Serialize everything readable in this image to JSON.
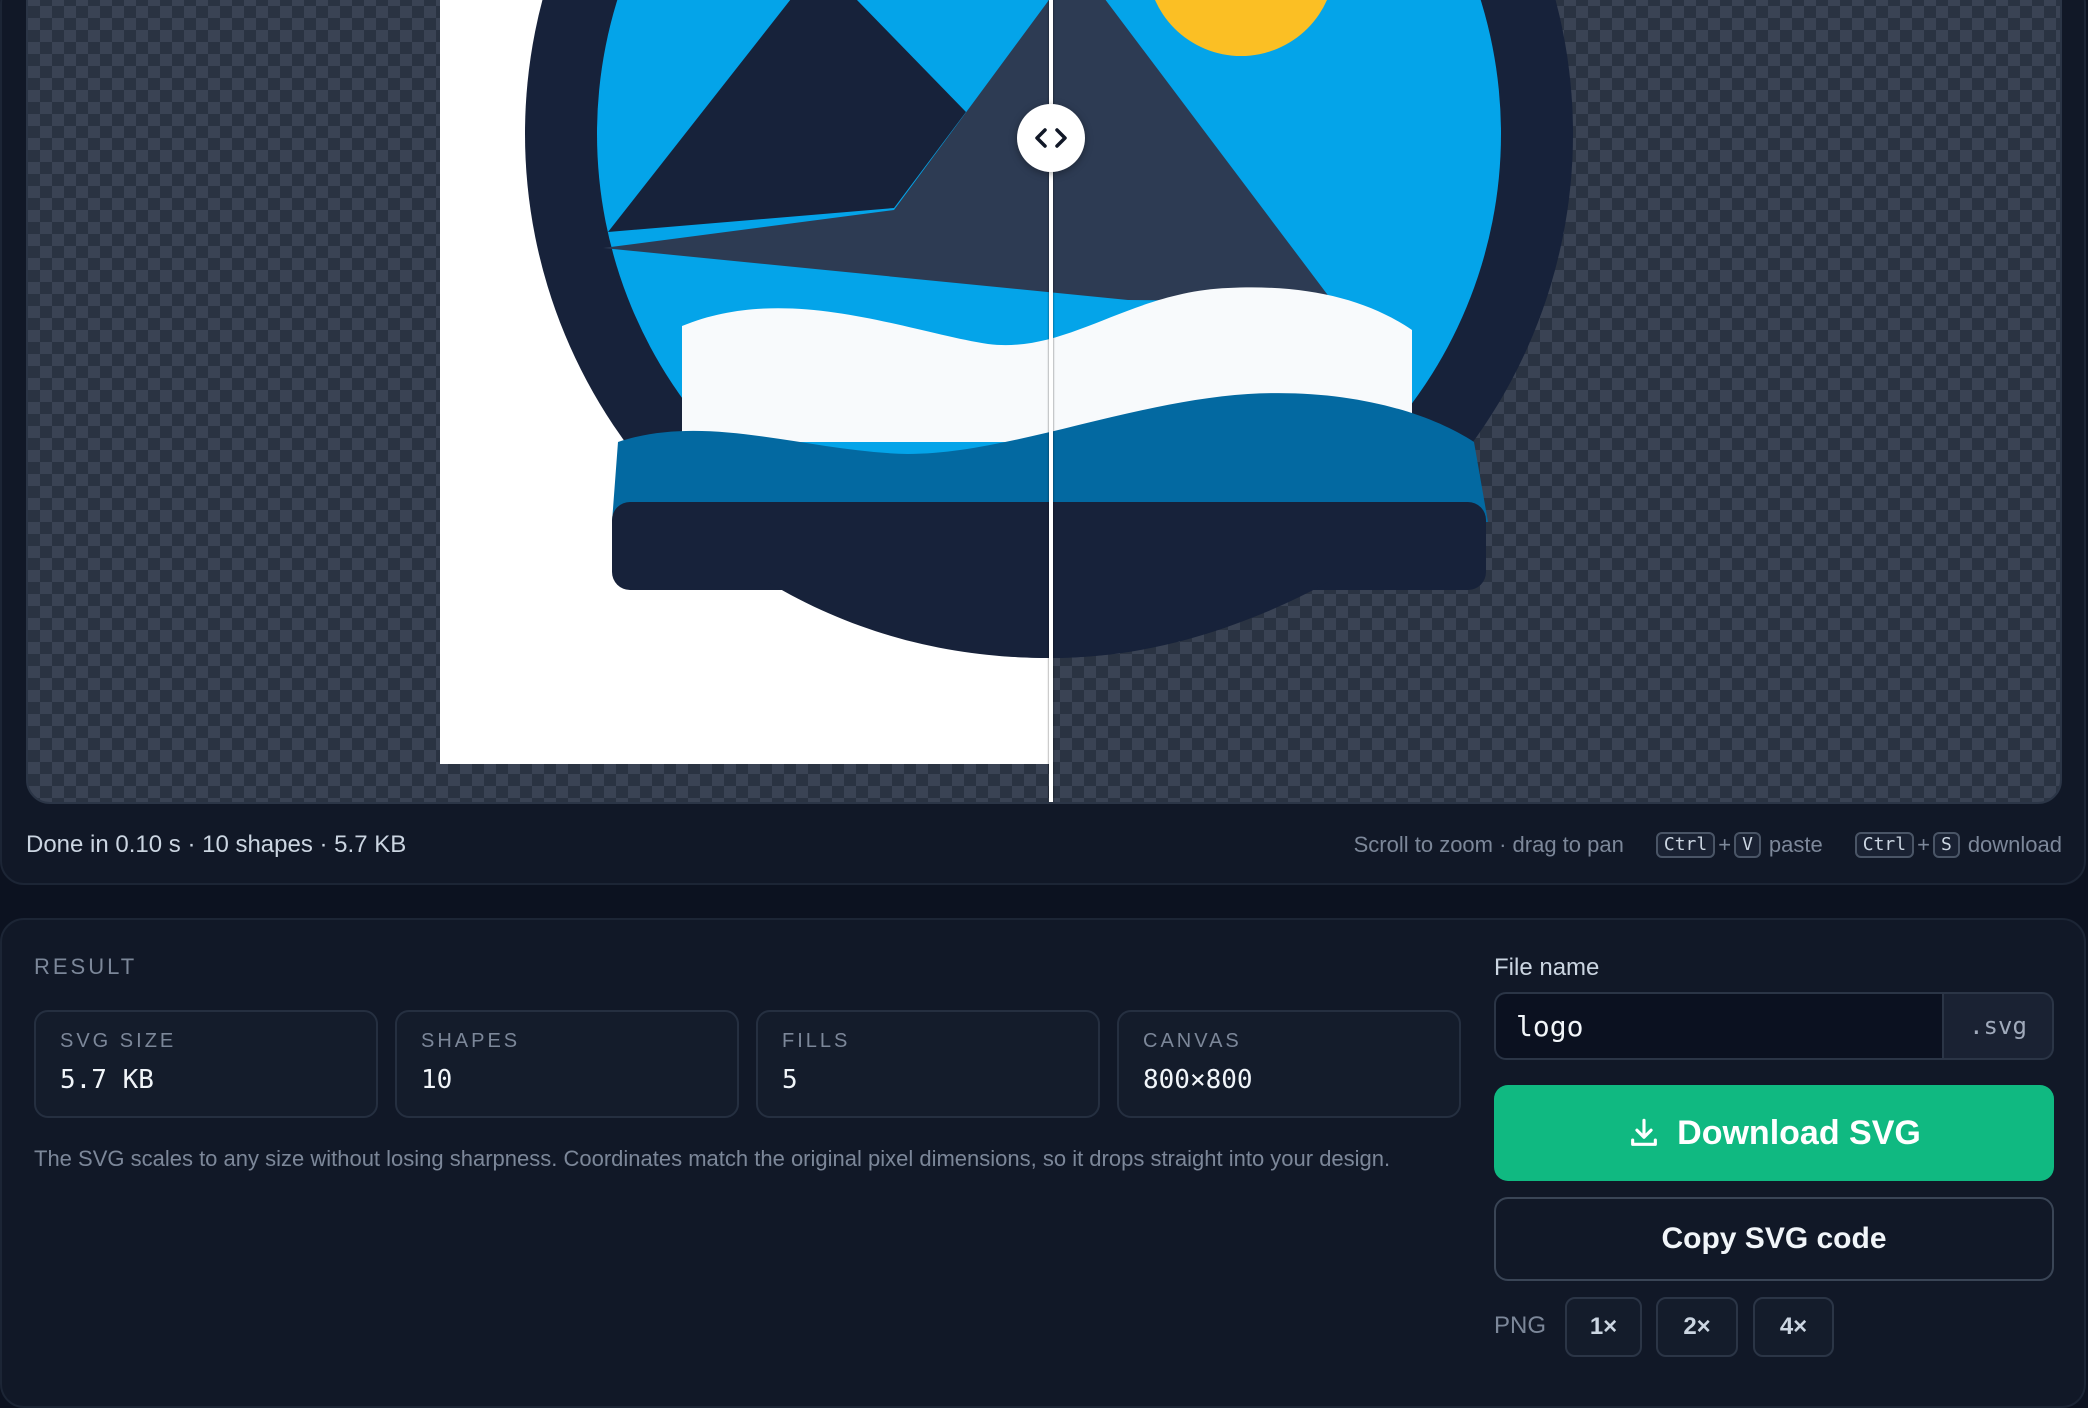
{
  "status": {
    "summary": "Done in 0.10 s · 10 shapes · 5.7 KB",
    "zoom_hint": "Scroll to zoom · drag to pan",
    "shortcuts": [
      {
        "mod": "Ctrl",
        "key": "V",
        "action": "paste"
      },
      {
        "mod": "Ctrl",
        "key": "S",
        "action": "download"
      }
    ]
  },
  "result": {
    "heading": "RESULT",
    "stats": [
      {
        "label": "SVG SIZE",
        "value": "5.7 KB"
      },
      {
        "label": "SHAPES",
        "value": "10"
      },
      {
        "label": "FILLS",
        "value": "5"
      },
      {
        "label": "CANVAS",
        "value": "800×800"
      }
    ],
    "note": "The SVG scales to any size without losing sharpness. Coordinates match the original pixel dimensions, so it drops straight into your design."
  },
  "export": {
    "file_name_label": "File name",
    "file_name_value": "logo",
    "extension": ".svg",
    "download_label": "Download SVG",
    "copy_label": "Copy SVG code",
    "png_label": "PNG",
    "png_scales": [
      "1×",
      "2×",
      "4×"
    ]
  },
  "colors": {
    "accent": "#10b981",
    "panel": "#111827",
    "logo_navy": "#17223a",
    "logo_sky": "#04a4e9",
    "logo_sun": "#fbbf24",
    "logo_wave": "#0369a1",
    "logo_slate": "#2d3b53"
  },
  "icons": {
    "handle": "code-brackets-icon",
    "download": "download-icon"
  }
}
